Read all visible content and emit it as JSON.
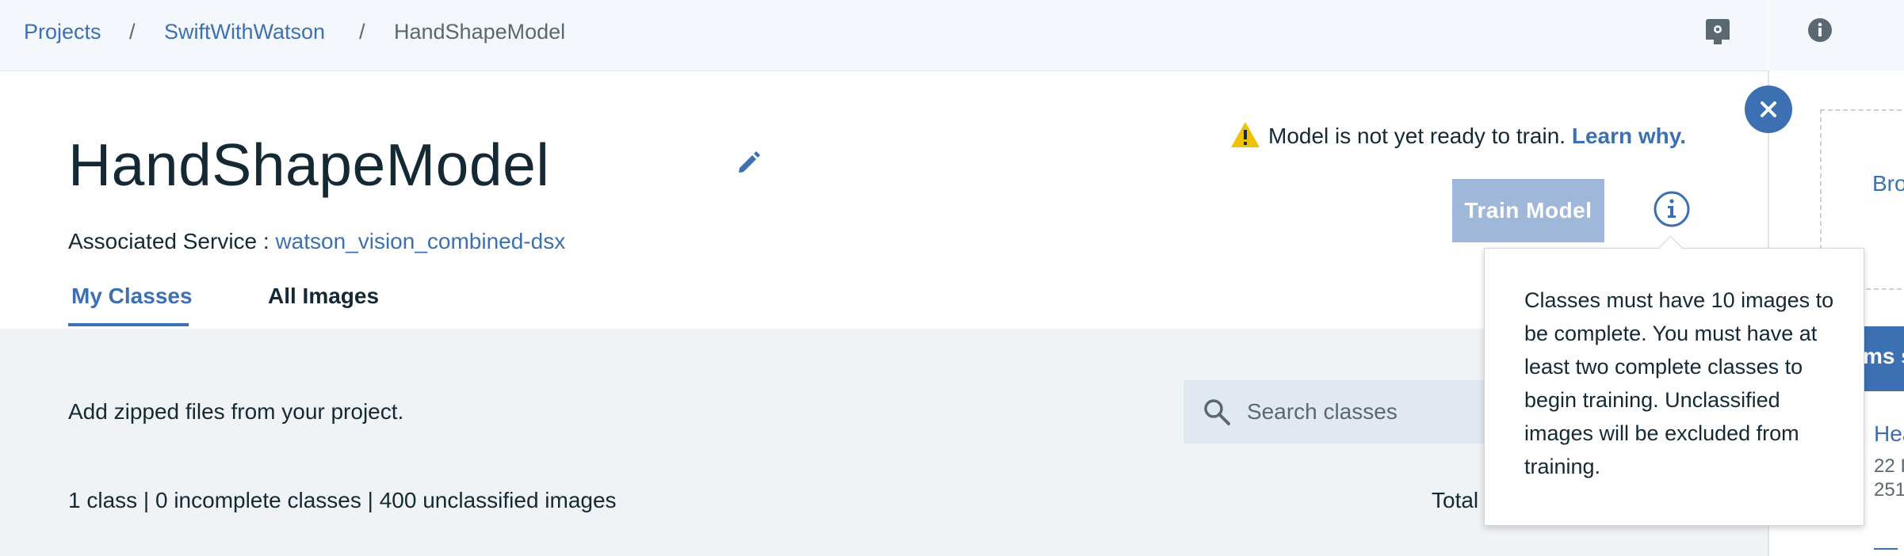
{
  "breadcrumb": {
    "items": [
      {
        "label": "Projects"
      },
      {
        "label": "SwiftWithWatson"
      },
      {
        "label": "HandShapeModel"
      }
    ],
    "separator": "/"
  },
  "header_icons": {
    "left": "notebook-icon",
    "right": "info-icon"
  },
  "model": {
    "title": "HandShapeModel",
    "service_label": "Associated Service :",
    "service_value": "watson_vision_combined-dsx",
    "edit_icon": "pencil-icon"
  },
  "tabs": [
    {
      "label": "My Classes",
      "active": true
    },
    {
      "label": "All Images",
      "active": false
    }
  ],
  "warning": {
    "icon": "warning-icon",
    "text": "Model is not yet ready to train.",
    "link": "Learn why."
  },
  "train_button": {
    "label": "Train Model",
    "disabled": true
  },
  "tooltip": {
    "text": "Classes must have 10 images to be complete. You must have at least two complete classes to begin training. Unclassified images will be excluded from training."
  },
  "content": {
    "add_zipped": "Add zipped files from your project.",
    "search_placeholder": "Search classes",
    "summary": "1 class | 0 incomplete classes | 400 unclassified images",
    "total_label": "Total"
  },
  "right_panel": {
    "browse_partial": "Bro",
    "banner_partial": "ms s",
    "item_title_partial": "Hea",
    "item_line1_partial": "22 I",
    "item_line2_partial": "251"
  },
  "colors": {
    "accent": "#3d70b2",
    "button_disabled": "#9fb8d9",
    "warning": "#efc100",
    "content_bg": "#f0f3f6"
  }
}
